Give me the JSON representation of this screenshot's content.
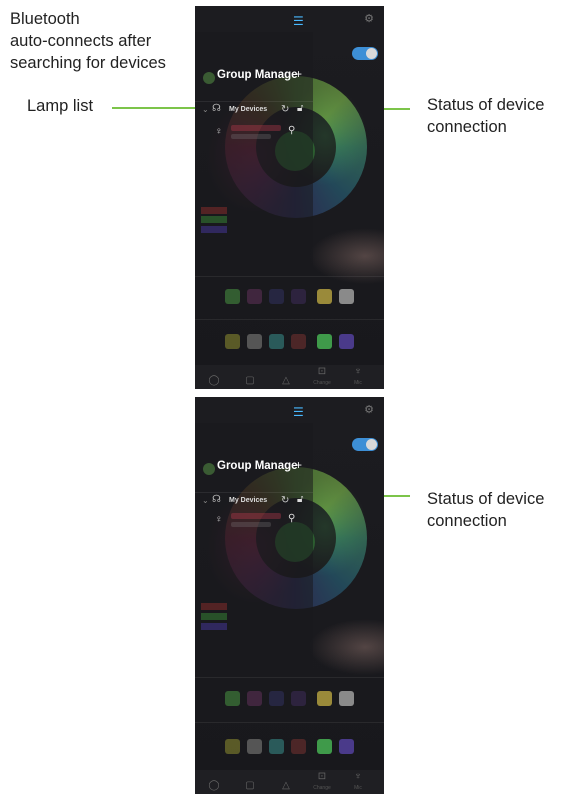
{
  "annotations": {
    "bluetooth_line1": "Bluetooth",
    "bluetooth_line2": "auto-connects after",
    "bluetooth_line3": "searching for devices",
    "lamp_list": "Lamp list",
    "status_line1": "Status of device",
    "status_line2": "connection"
  },
  "colors": {
    "arrow": "#7cc44a",
    "accent_blue": "#49b9ff",
    "toggle_on": "#3d8fd6"
  },
  "screens": [
    {
      "header": {
        "title": "Group Manage",
        "add_icon": "plus-icon"
      },
      "devices": {
        "label": "My Devices"
      },
      "tabs": [
        "",
        "",
        "",
        "Change",
        "Mic"
      ]
    },
    {
      "header": {
        "title": "Group Manage",
        "add_icon": "plus-icon"
      },
      "devices": {
        "label": "My Devices"
      },
      "tabs": [
        "",
        "",
        "",
        "Change",
        "Mic"
      ]
    }
  ]
}
